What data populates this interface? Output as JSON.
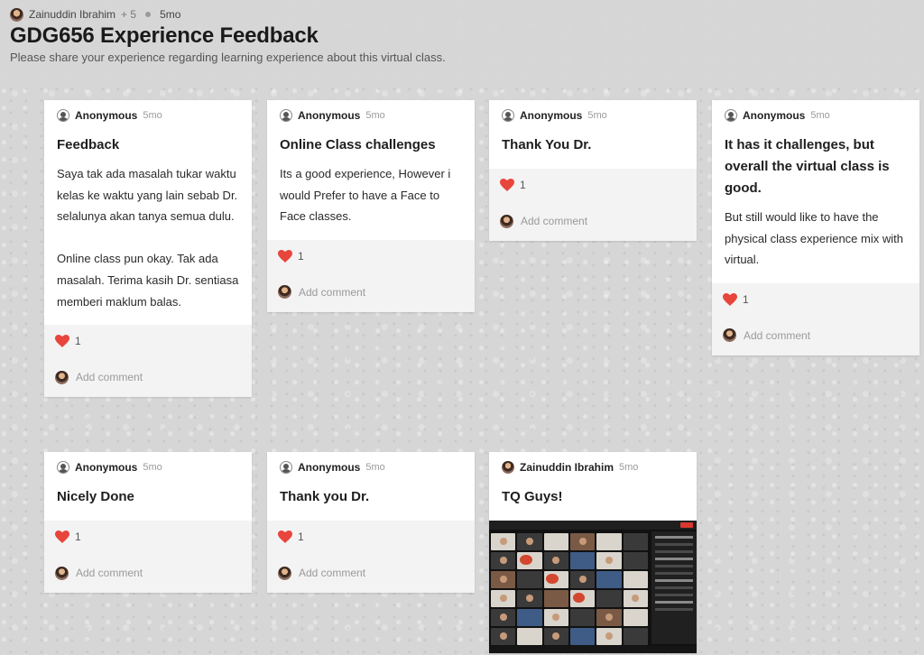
{
  "header": {
    "owner_name": "Zainuddin Ibrahim",
    "collaborators": "+ 5",
    "age": "5mo",
    "title": "GDG656 Experience Feedback",
    "description": "Please share your experience regarding learning experience about this virtual class."
  },
  "cards": [
    {
      "author": "Anonymous",
      "time": "5mo",
      "title": "Feedback",
      "body": "Saya tak ada masalah tukar waktu kelas ke waktu yang lain sebab Dr. selalunya akan tanya semua dulu.\n\nOnline class pun okay. Tak ada masalah. Terima kasih Dr. sentiasa memberi maklum balas.",
      "likes": "1",
      "comment_placeholder": "Add comment"
    },
    {
      "author": "Anonymous",
      "time": "5mo",
      "title": "Online Class challenges",
      "body": "Its a good experience, However i would Prefer to have a Face to Face classes.",
      "likes": "1",
      "comment_placeholder": "Add comment"
    },
    {
      "author": "Anonymous",
      "time": "5mo",
      "title": "Thank You Dr.",
      "likes": "1",
      "comment_placeholder": "Add comment"
    },
    {
      "author": "Anonymous",
      "time": "5mo",
      "title": "It has it challenges, but overall the virtual class is good.",
      "body": "But still would like to have the physical class experience mix with virtual.",
      "likes": "1",
      "comment_placeholder": "Add comment"
    },
    {
      "author": "Anonymous",
      "time": "5mo",
      "title": "Nicely Done",
      "likes": "1",
      "comment_placeholder": "Add comment"
    },
    {
      "author": "Anonymous",
      "time": "5mo",
      "title": "Thank you Dr.",
      "likes": "1",
      "comment_placeholder": "Add comment"
    },
    {
      "author": "Zainuddin Ibrahim",
      "time": "5mo",
      "title": "TQ Guys!",
      "attachment": "video-call-screenshot"
    }
  ],
  "colors": {
    "heart": "#e8453c",
    "background": "#d6d6d6",
    "card": "#ffffff",
    "footer": "#f3f3f3"
  }
}
